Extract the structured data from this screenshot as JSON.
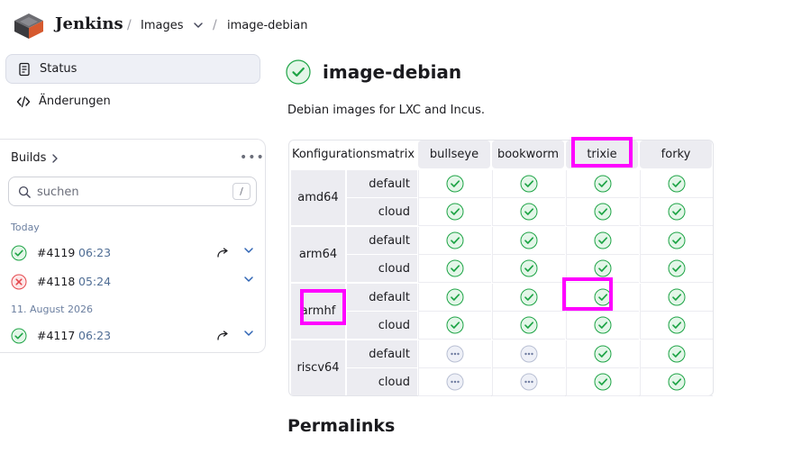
{
  "header": {
    "brand": "Jenkins",
    "breadcrumbs": [
      "Images",
      "image-debian"
    ]
  },
  "sidebar": {
    "nav": [
      {
        "label": "Status",
        "icon": "document-icon",
        "active": true
      },
      {
        "label": "Änderungen",
        "icon": "code-icon",
        "active": false
      }
    ],
    "builds": {
      "title": "Builds",
      "search_placeholder": "suchen",
      "search_shortcut": "/",
      "groups": [
        {
          "label": "Today",
          "items": [
            {
              "number": "#4119",
              "time": "06:23",
              "status": "success"
            },
            {
              "number": "#4118",
              "time": "05:24",
              "status": "failed"
            }
          ]
        },
        {
          "label": "11. August 2026",
          "items": [
            {
              "number": "#4117",
              "time": "06:23",
              "status": "success"
            }
          ]
        }
      ]
    }
  },
  "main": {
    "title": "image-debian",
    "title_status": "success",
    "description": "Debian images for LXC and Incus.",
    "matrix": {
      "corner": "Konfigurationsmatrix",
      "columns": [
        "bullseye",
        "bookworm",
        "trixie",
        "forky"
      ],
      "rows": [
        {
          "arch": "amd64",
          "variants": [
            {
              "name": "default",
              "status": [
                "success",
                "success",
                "success",
                "success"
              ]
            },
            {
              "name": "cloud",
              "status": [
                "success",
                "success",
                "success",
                "success"
              ]
            }
          ]
        },
        {
          "arch": "arm64",
          "variants": [
            {
              "name": "default",
              "status": [
                "success",
                "success",
                "success",
                "success"
              ]
            },
            {
              "name": "cloud",
              "status": [
                "success",
                "success",
                "success",
                "success"
              ]
            }
          ]
        },
        {
          "arch": "armhf",
          "variants": [
            {
              "name": "default",
              "status": [
                "success",
                "success",
                "success",
                "success"
              ]
            },
            {
              "name": "cloud",
              "status": [
                "success",
                "success",
                "success",
                "success"
              ]
            }
          ]
        },
        {
          "arch": "riscv64",
          "variants": [
            {
              "name": "default",
              "status": [
                "not-built",
                "not-built",
                "success",
                "success"
              ]
            },
            {
              "name": "cloud",
              "status": [
                "not-built",
                "not-built",
                "success",
                "success"
              ]
            }
          ]
        }
      ]
    },
    "permalinks_heading": "Permalinks"
  },
  "colors": {
    "success": "#1ea446",
    "success_bg": "#e3f6e8",
    "failed": "#e5484d",
    "failed_bg": "#fde7e8",
    "pending": "#6e7ba0",
    "highlight": "#ff00ff"
  }
}
